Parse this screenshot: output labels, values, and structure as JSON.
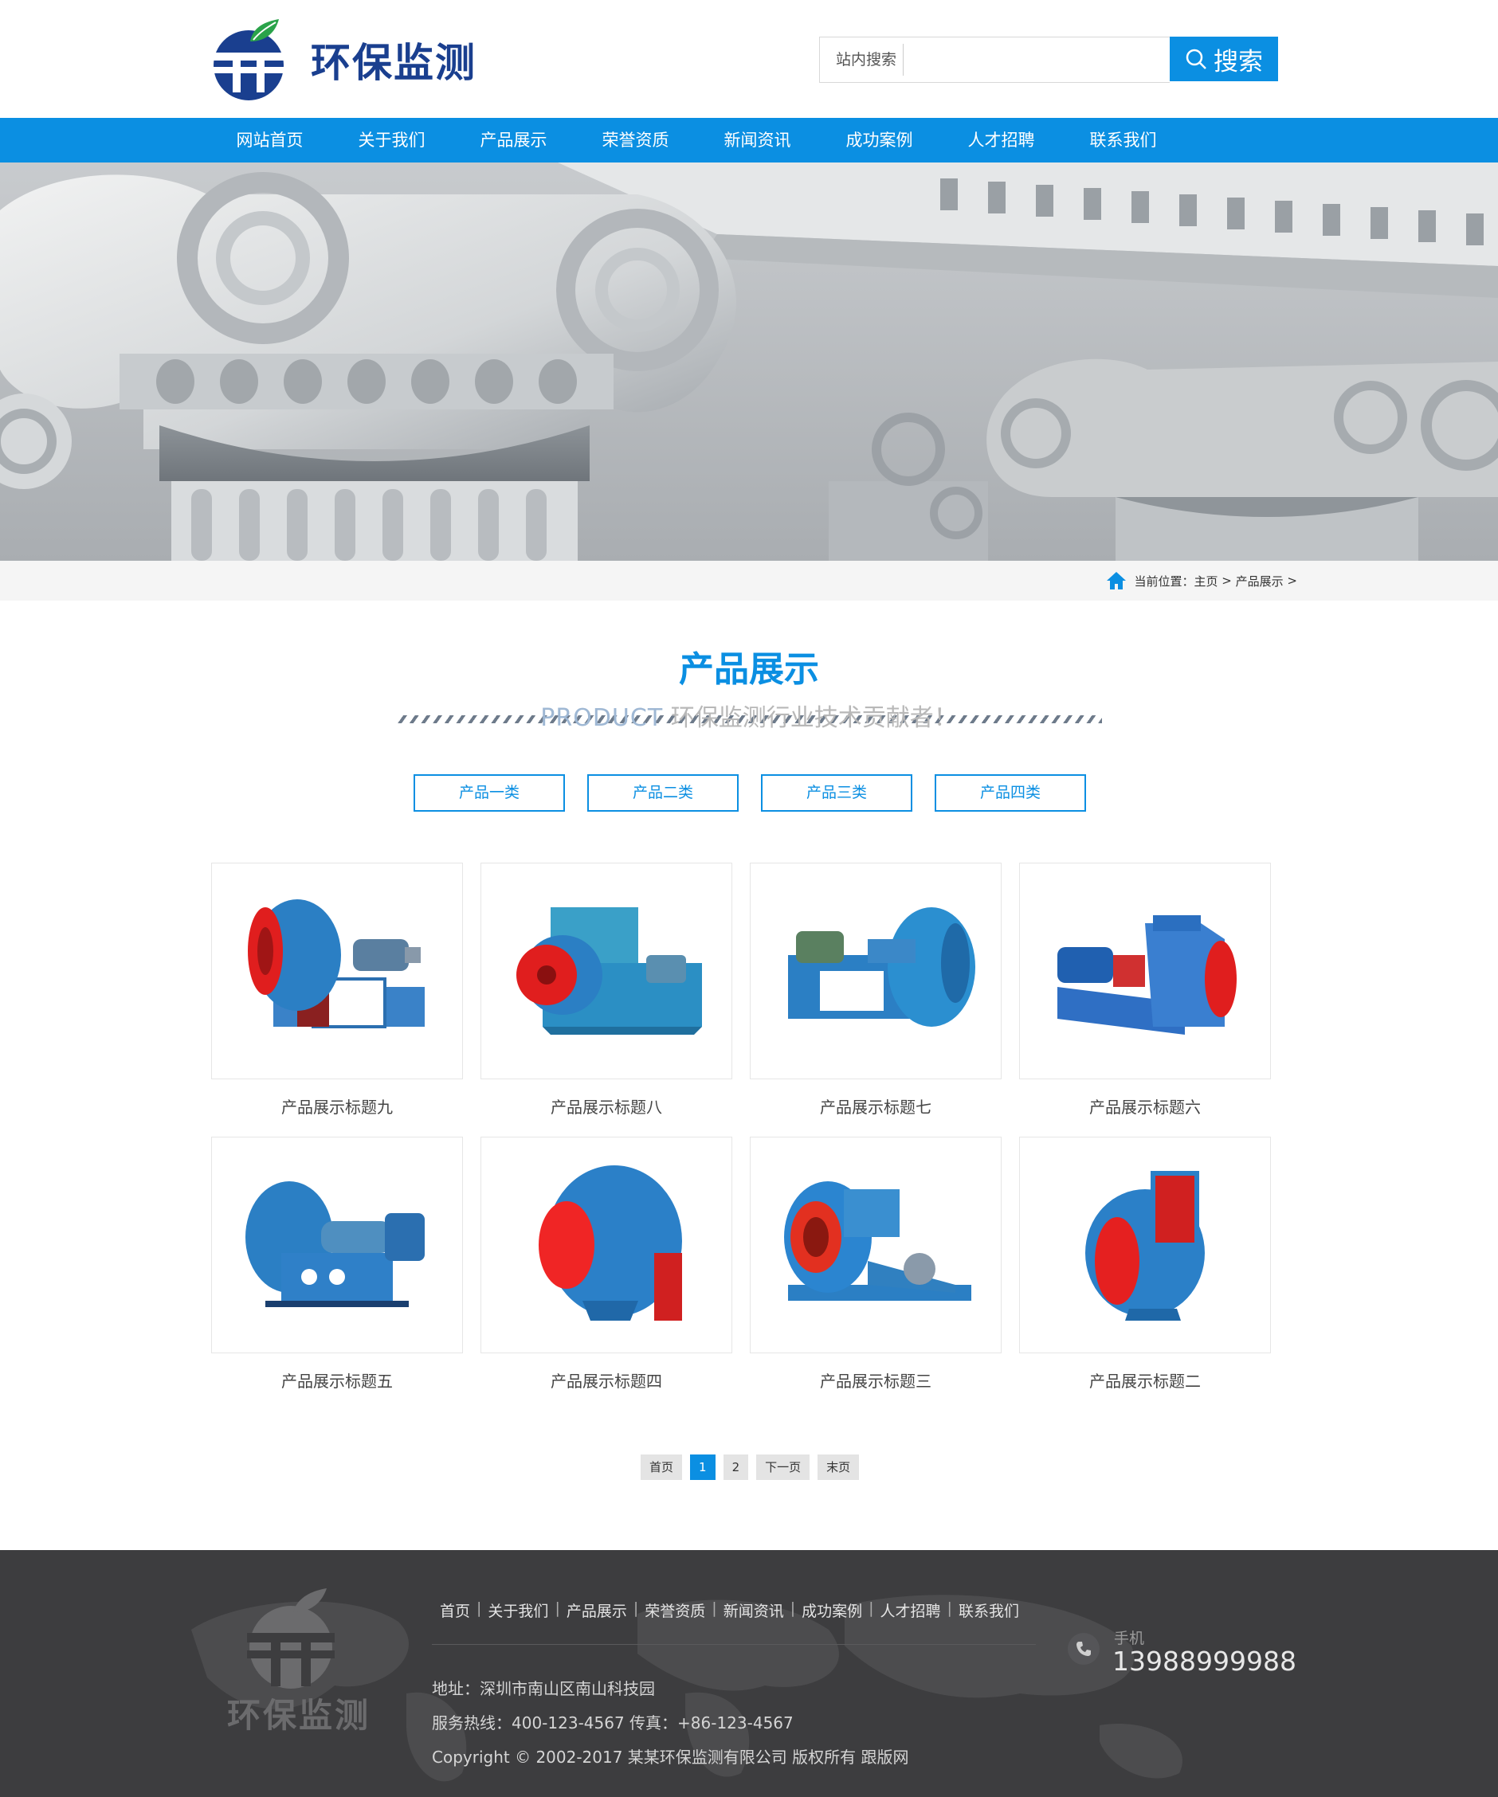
{
  "header": {
    "logo_text": "环保监测",
    "search_label": "站内搜索",
    "search_placeholder": "",
    "search_button": "搜索"
  },
  "nav": {
    "items": [
      "网站首页",
      "关于我们",
      "产品展示",
      "荣誉资质",
      "新闻资讯",
      "成功案例",
      "人才招聘",
      "联系我们"
    ]
  },
  "breadcrumb": {
    "prefix": "当前位置：",
    "home": "主页",
    "sep1": " > ",
    "current": "产品展示",
    "sep2": " >"
  },
  "section": {
    "title": "产品展示",
    "subtitle_en": "PRODUCT",
    "subtitle_cn": " 环保监测行业技术贡献者！"
  },
  "categories": [
    "产品一类",
    "产品二类",
    "产品三类",
    "产品四类"
  ],
  "products": [
    {
      "title": "产品展示标题九"
    },
    {
      "title": "产品展示标题八"
    },
    {
      "title": "产品展示标题七"
    },
    {
      "title": "产品展示标题六"
    },
    {
      "title": "产品展示标题五"
    },
    {
      "title": "产品展示标题四"
    },
    {
      "title": "产品展示标题三"
    },
    {
      "title": "产品展示标题二"
    }
  ],
  "pagination": {
    "first": "首页",
    "pages": [
      "1",
      "2"
    ],
    "current": "1",
    "next": "下一页",
    "last": "末页"
  },
  "footer": {
    "logo_text": "环保监测",
    "nav": [
      "首页",
      "关于我们",
      "产品展示",
      "荣誉资质",
      "新闻资讯",
      "成功案例",
      "人才招聘",
      "联系我们"
    ],
    "address": "地址：深圳市南山区南山科技园",
    "hotline": "服务热线：400-123-4567 传真：+86-123-4567",
    "copyright": "Copyright © 2002-2017 某某环保监测有限公司 版权所有 跟版网",
    "phone_label": "手机",
    "phone_number": "13988999988"
  },
  "colors": {
    "primary": "#0b8fe2",
    "logo_blue": "#1a3f8f",
    "footer_bg": "#3d3d3f",
    "fan_blue": "#2b7fc4",
    "fan_red": "#e01e1e"
  },
  "icons": {
    "search": "search-icon",
    "home": "home-icon",
    "phone": "phone-icon"
  }
}
